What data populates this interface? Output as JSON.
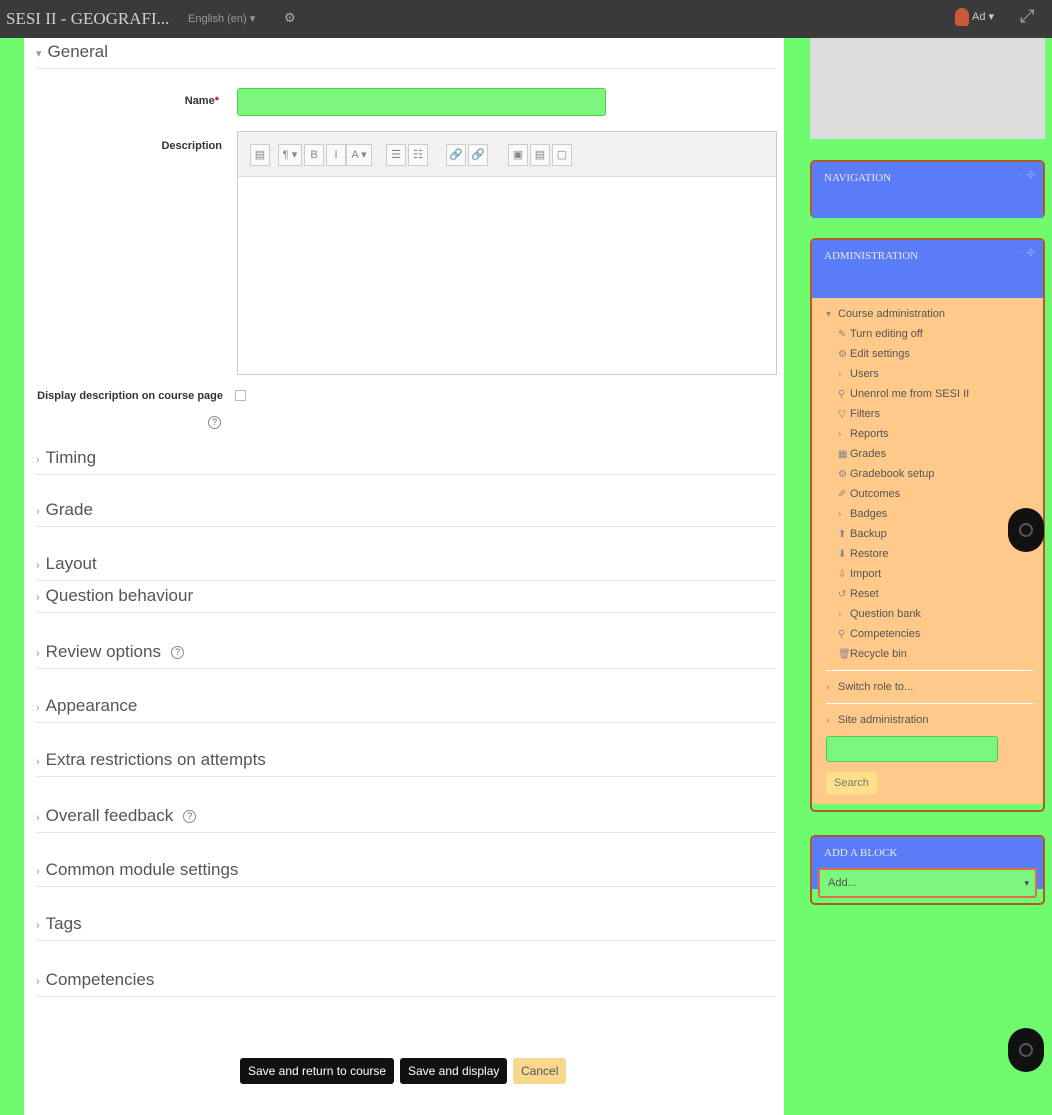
{
  "topbar": {
    "course_title": "SESI II - GEOGRAFI...",
    "language": "English (en) ▾",
    "gear": "⚙",
    "user_menu": "Ad ▾",
    "expand": "⤢"
  },
  "form": {
    "general": "General",
    "name_label": "Name",
    "required_mark": "*",
    "description_label": "Description",
    "display_desc_label": "Display description on course page",
    "toolbar": [
      "▤",
      "¶ ▾",
      "B",
      "I",
      "A ▾",
      "☰",
      "☷",
      "🔗",
      "🔗",
      "▣",
      "▤",
      "▢"
    ],
    "sections": [
      "Timing",
      "Grade",
      "Layout",
      "Question behaviour",
      "Review options",
      "Appearance",
      "Extra restrictions on attempts",
      "Overall feedback",
      "Common module settings",
      "Tags",
      "Competencies"
    ],
    "buttons": {
      "save_return": "Save and return to course",
      "save_display": "Save and display",
      "cancel": "Cancel"
    }
  },
  "sidebar": {
    "navigation_title": "NAVIGATION",
    "administration_title": "ADMINISTRATION",
    "course_admin": "Course administration",
    "admin_items": [
      "Turn editing off",
      "Edit settings",
      "Users",
      "Unenrol me from SESI II",
      "Filters",
      "Reports",
      "Grades",
      "Gradebook setup",
      "Outcomes",
      "Badges",
      "Backup",
      "Restore",
      "Import",
      "Reset",
      "Question bank",
      "Competencies",
      "Recycle bin"
    ],
    "switch_role": "Switch role to...",
    "site_admin": "Site administration",
    "search_button": "Search",
    "add_block_title": "ADD A BLOCK",
    "add_select": "Add..."
  },
  "colors": {
    "background": "#6efc6e",
    "block_header": "#5b7cf7",
    "admin_body": "#ffc98a",
    "input": "#7cf57c"
  }
}
